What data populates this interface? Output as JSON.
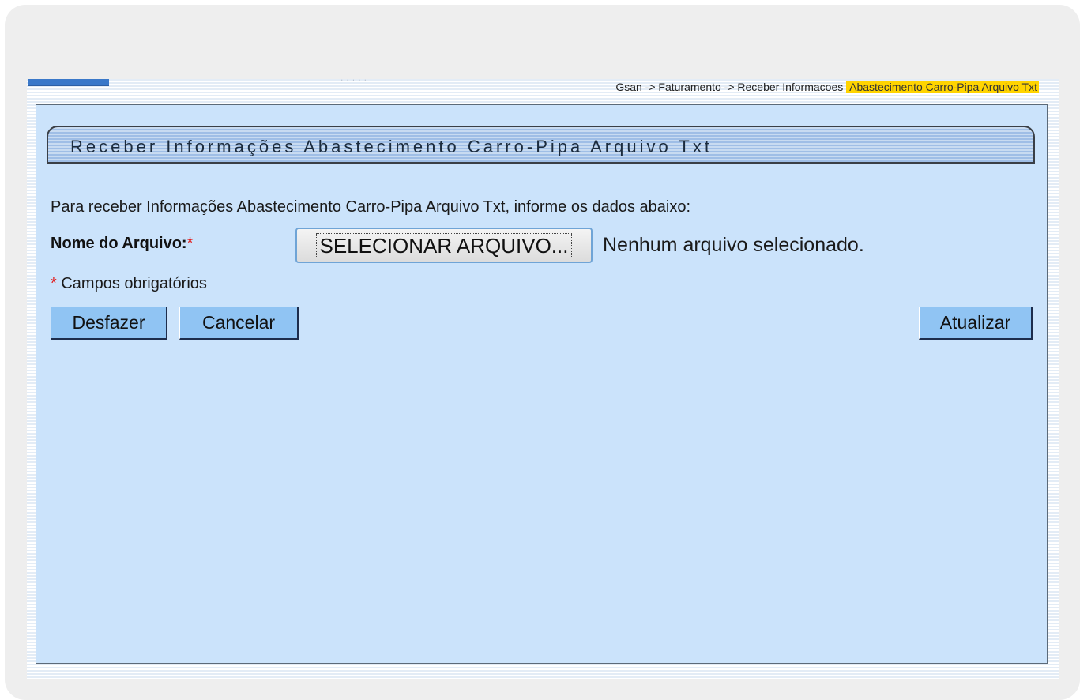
{
  "breadcrumb": {
    "path": "Gsan -> Faturamento -> Receber Informacoes ",
    "current": "Abastecimento Carro-Pipa Arquivo Txt"
  },
  "panel": {
    "title": "Receber Informações Abastecimento Carro-Pipa Arquivo Txt"
  },
  "form": {
    "intro": "Para receber Informações Abastecimento Carro-Pipa Arquivo Txt, informe os dados abaixo:",
    "file_label": "Nome do Arquivo:",
    "required_marker": "*",
    "file_button_label": "SELECIONAR ARQUIVO...",
    "file_status": "Nenhum arquivo selecionado.",
    "required_note": "Campos obrigatórios"
  },
  "buttons": {
    "undo": "Desfazer",
    "cancel": "Cancelar",
    "update": "Atualizar"
  },
  "colors": {
    "panel_bg": "#cbe3fb",
    "button_bg": "#90c4f3",
    "highlight": "#ffd400",
    "required": "#e21a1a"
  }
}
